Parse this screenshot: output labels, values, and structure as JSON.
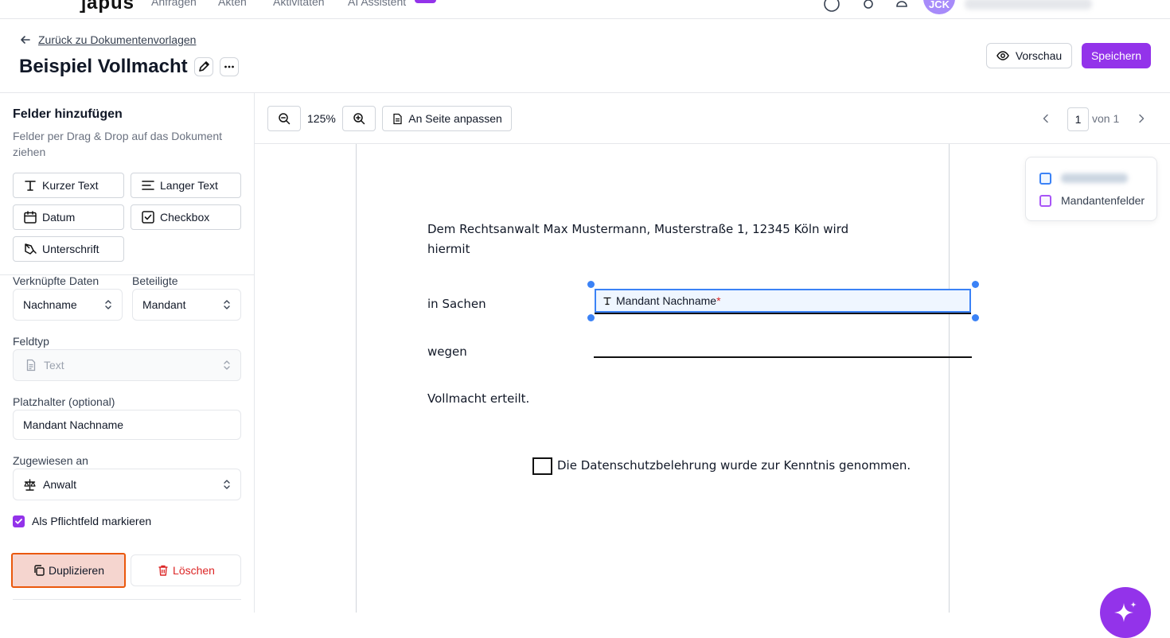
{
  "nav": {
    "logo": "]apus",
    "items": [
      "Anfragen",
      "Akten",
      "Aktivitäten",
      "AI Assistent"
    ],
    "avatar_initials": "JCK"
  },
  "header": {
    "back_label": "Zurück zu Dokumentenvorlagen",
    "title": "Beispiel Vollmacht",
    "preview_label": "Vorschau",
    "save_label": "Speichern"
  },
  "sidebar": {
    "title": "Felder hinzufügen",
    "description": "Felder per Drag & Drop auf das Dokument ziehen",
    "field_buttons": {
      "short_text": "Kurzer Text",
      "long_text": "Langer Text",
      "date": "Datum",
      "checkbox": "Checkbox",
      "signature": "Unterschrift"
    },
    "linked_data_label": "Verknüpfte Daten",
    "linked_data_value": "Nachname",
    "participants_label": "Beteiligte",
    "participants_value": "Mandant",
    "field_type_label": "Feldtyp",
    "field_type_value": "Text",
    "placeholder_label": "Platzhalter (optional)",
    "placeholder_value": "Mandant Nachname",
    "assigned_label": "Zugewiesen an",
    "assigned_value": "Anwalt",
    "required_label": "Als Pflichtfeld markieren",
    "required_checked": true,
    "duplicate_label": "Duplizieren",
    "delete_label": "Löschen"
  },
  "toolbar": {
    "zoom": "125%",
    "fit_label": "An Seite anpassen",
    "page": "1",
    "page_of": "von 1"
  },
  "document": {
    "line1": "Dem Rechtsanwalt Max Mustermann, Musterstraße 1, 12345 Köln wird",
    "line2": "hiermit",
    "in_sachen": "in Sachen",
    "field_label": "Mandant Nachname",
    "field_required_marker": "*",
    "wegen": "wegen",
    "vollmacht": "Vollmacht erteilt.",
    "checkbox_text": "Die Datenschutzbelehrung wurde zur Kenntnis genommen."
  },
  "legend": {
    "items": [
      {
        "label": "Anwaltsfelder",
        "color": "#3b82f6",
        "blurred": true
      },
      {
        "label": "Mandantenfelder",
        "color": "#a855f7"
      }
    ]
  },
  "colors": {
    "accent": "#9333ea",
    "field_border": "#3b82f6",
    "danger": "#dc2626",
    "duplicate_focus": "#ea580c"
  }
}
